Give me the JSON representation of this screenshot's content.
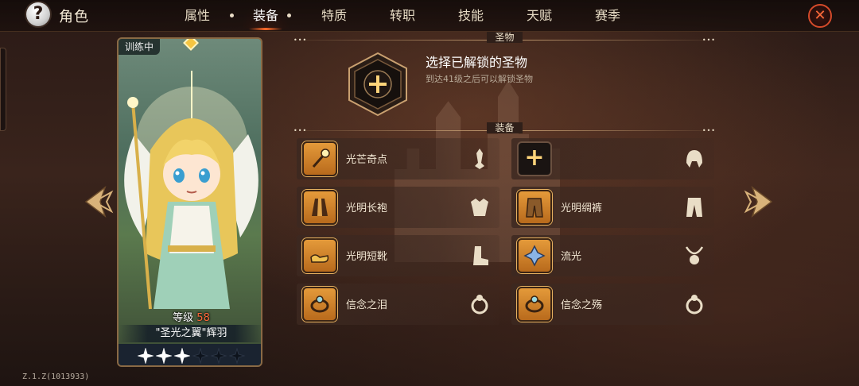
{
  "header": {
    "title": "角色",
    "tabs": [
      {
        "label": "属性",
        "active": false
      },
      {
        "label": "装备",
        "active": true
      },
      {
        "label": "特质",
        "active": false
      },
      {
        "label": "转职",
        "active": false
      },
      {
        "label": "技能",
        "active": false
      },
      {
        "label": "天赋",
        "active": false
      },
      {
        "label": "赛季",
        "active": false
      }
    ]
  },
  "character": {
    "status_badge": "训练中",
    "level_label": "等级",
    "level_value": "58",
    "name": "\"圣光之翼\"辉羽",
    "stars_filled": 3,
    "stars_total": 6
  },
  "relic_section": {
    "header": "圣物",
    "title": "选择已解锁的圣物",
    "subtitle": "到达41级之后可以解锁圣物"
  },
  "equipment_section": {
    "header": "装备",
    "slots": [
      {
        "name": "光芒奇点",
        "icon": "scepter-icon",
        "type_icon": "weapon-slot-icon",
        "empty": false
      },
      {
        "name": "",
        "icon": "add-icon",
        "type_icon": "helmet-slot-icon",
        "empty": true
      },
      {
        "name": "光明长袍",
        "icon": "robe-icon",
        "type_icon": "armor-slot-icon",
        "empty": false
      },
      {
        "name": "光明绸裤",
        "icon": "pants-icon",
        "type_icon": "pants-slot-icon",
        "empty": false
      },
      {
        "name": "光明短靴",
        "icon": "boots-icon",
        "type_icon": "boots-slot-icon",
        "empty": false
      },
      {
        "name": "流光",
        "icon": "crystal-icon",
        "type_icon": "necklace-slot-icon",
        "empty": false
      },
      {
        "name": "信念之泪",
        "icon": "ring-icon",
        "type_icon": "ring-slot-icon",
        "empty": false
      },
      {
        "name": "信念之殇",
        "icon": "ring-icon",
        "type_icon": "ring-slot-icon",
        "empty": false
      }
    ]
  },
  "footer": {
    "version": "Z.1.Z(1013933)"
  },
  "colors": {
    "accent": "#ff6a2a",
    "gold": "#e49a3a",
    "level_number": "#ff6a3a"
  }
}
